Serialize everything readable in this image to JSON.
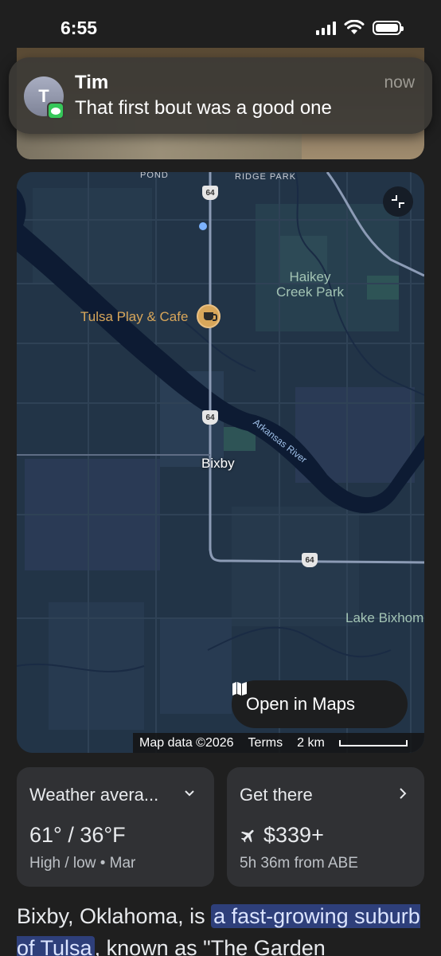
{
  "status_bar": {
    "time": "6:55"
  },
  "notification": {
    "avatar_initial": "T",
    "sender": "Tim",
    "message": "That first bout was a good one",
    "time": "now"
  },
  "map": {
    "labels": {
      "pond": "POND",
      "ridge_park": "RIDGE PARK",
      "haikey_line1": "Haikey",
      "haikey_line2": "Creek Park",
      "poi": "Tulsa Play & Cafe",
      "city": "Bixby",
      "river": "Arkansas River",
      "lake": "Lake Bixhom"
    },
    "route_shields": [
      "64",
      "64",
      "64"
    ],
    "open_maps_label": "Open in Maps",
    "attribution": "Map data ©2026",
    "terms": "Terms",
    "scale": "2 km"
  },
  "cards": {
    "weather": {
      "title": "Weather avera...",
      "temps": "61° / 36°F",
      "detail": "High / low • Mar"
    },
    "travel": {
      "title": "Get there",
      "price": "$339+",
      "detail": "5h 36m from ABE"
    }
  },
  "description": {
    "before": "Bixby, Oklahoma, is ",
    "highlight": "a fast-growing suburb of Tulsa",
    "after": ", known as \"The Garden"
  },
  "colors": {
    "map_water": "#0d1b33",
    "map_land": "#223447",
    "poi": "#d8a65a",
    "highlight": "#2e3f7a"
  }
}
